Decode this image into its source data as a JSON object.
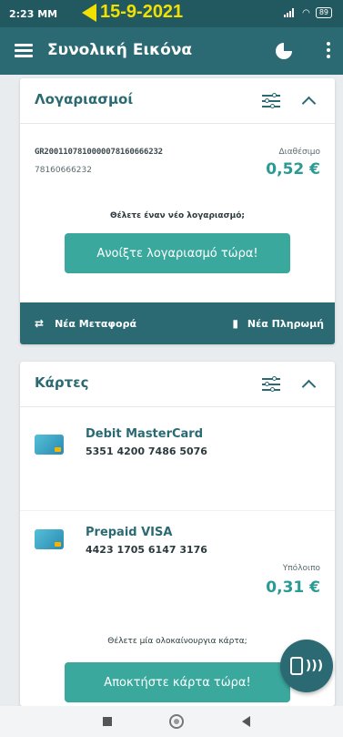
{
  "status_bar": {
    "time": "2:23 MM",
    "date_annotation": "15-9-2021",
    "battery": "89"
  },
  "app_bar": {
    "title": "Συνολική Εικόνα",
    "icons": [
      "menu-icon",
      "pie-chart-icon",
      "more-vert-icon"
    ]
  },
  "accounts": {
    "heading": "Λογαριασμοί",
    "items": [
      {
        "iban": "GR2001107810000078160666232",
        "number": "78160666232",
        "balance_label": "Διαθέσιμο",
        "balance": "0,52 €"
      }
    ],
    "new_prompt": "Θέλετε έναν νέο λογαριασμό;",
    "open_button": "Ανοίξτε λογαριασμό τώρα!",
    "actions": {
      "transfer": "Νέα Μεταφορά",
      "payment": "Νέα Πληρωμή"
    }
  },
  "cards": {
    "heading": "Κάρτες",
    "items": [
      {
        "name": "Debit MasterCard",
        "number": "5351 4200 7486 5076"
      },
      {
        "name": "Prepaid VISA",
        "number": "4423 1705 6147 3176",
        "balance_label": "Υπόλοιπο",
        "balance": "0,31 €"
      }
    ],
    "new_prompt": "Θέλετε μία ολοκαίνουργια κάρτα;",
    "get_button": "Αποκτήστε κάρτα τώρα!"
  },
  "colors": {
    "primary": "#2b6a72",
    "accent": "#3ba89e",
    "balance": "#2a9a94"
  }
}
